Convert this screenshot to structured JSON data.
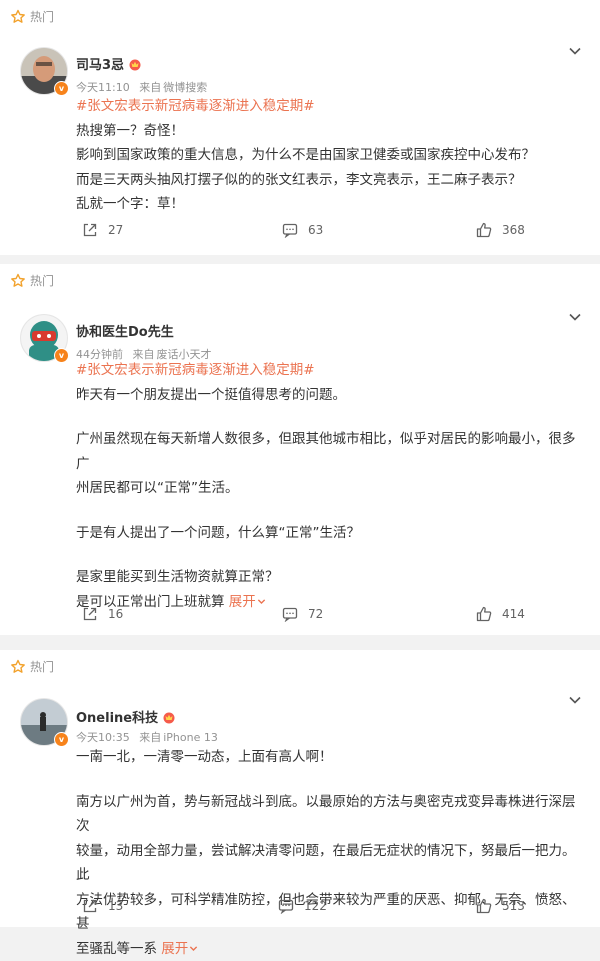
{
  "section_label": "热门",
  "posts": [
    {
      "user": "司马3忌",
      "time": "今天11:10",
      "source_prefix": "来自",
      "source": "微博搜索",
      "topic": "#张文宏表示新冠病毒逐渐进入稳定期#",
      "lines": [
        "热搜第一？奇怪！",
        "影响到国家政策的重大信息，为什么不是由国家卫健委或国家疾控中心发布？",
        "而是三天两头抽风打摆子似的的张文红表示，李文亮表示，王二麻子表示？",
        "乱就一个字：草！"
      ],
      "reposts": "27",
      "comments": "63",
      "likes": "368"
    },
    {
      "user": "协和医生Do先生",
      "time": "44分钟前",
      "source_prefix": "来自",
      "source": "废话小天才",
      "topic": "#张文宏表示新冠病毒逐渐进入稳定期#",
      "para1": "昨天有一个朋友提出一个挺值得思考的问题。",
      "para2a": "广州虽然现在每天新增人数很多，但跟其他城市相比，似乎对居民的影响最小，很多广",
      "para2b": "州居民都可以“正常”生活。",
      "para3": "于是有人提出了一个问题，什么算“正常”生活？",
      "para4a": "是家里能买到生活物资就算正常？",
      "para4b": "是可以正常出门上班就算",
      "expand": "展开",
      "reposts": "16",
      "comments": "72",
      "likes": "414"
    },
    {
      "user": "Oneline科技",
      "time": "今天10:35",
      "source_prefix": "来自",
      "source": "iPhone 13",
      "para1": "一南一北，一清零一动态，上面有高人啊！",
      "para2a": "南方以广州为首，势与新冠战斗到底。以最原始的方法与奥密克戎变异毒株进行深层次",
      "para2b": "较量，动用全部力量，尝试解决清零问题，在最后无症状的情况下，努最后一把力。此",
      "para2c": "方法优势较多，可科学精准防控，但也会带来较为严重的厌恶、抑郁、无奈、愤怒、甚",
      "para2d": "至骚乱等一系",
      "expand": "展开",
      "reposts": "13",
      "comments": "122",
      "likes": "513"
    }
  ],
  "colors": {
    "accent": "#eb7350",
    "badge": "#f7831b",
    "muted": "#939393",
    "background": "#f2f2f2"
  }
}
